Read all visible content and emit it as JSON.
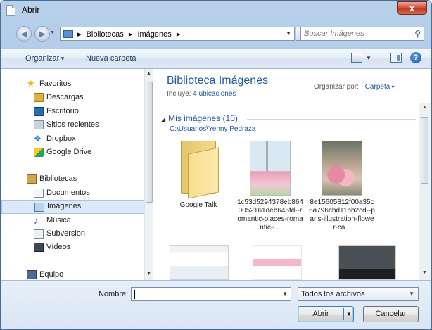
{
  "window": {
    "title": "Abrir",
    "close_glyph": "x"
  },
  "address": {
    "crumbs": [
      "Bibliotecas",
      "Imágenes"
    ],
    "search_placeholder": "Buscar Imágenes"
  },
  "toolbar": {
    "organize_label": "Organizar",
    "new_folder_label": "Nueva carpeta",
    "help_glyph": "?"
  },
  "nav": {
    "items": [
      {
        "label": "Favoritos",
        "icon": "star-icon",
        "group": true
      },
      {
        "label": "Descargas",
        "icon": "downloads-folder-icon"
      },
      {
        "label": "Escritorio",
        "icon": "desktop-icon"
      },
      {
        "label": "Sitios recientes",
        "icon": "recent-places-icon"
      },
      {
        "label": "Dropbox",
        "icon": "dropbox-icon"
      },
      {
        "label": "Google Drive",
        "icon": "google-drive-icon"
      },
      {
        "label": "Bibliotecas",
        "icon": "libraries-icon",
        "group": true
      },
      {
        "label": "Documentos",
        "icon": "documents-icon"
      },
      {
        "label": "Imágenes",
        "icon": "pictures-icon",
        "selected": true
      },
      {
        "label": "Música",
        "icon": "music-icon"
      },
      {
        "label": "Subversion",
        "icon": "subversion-icon"
      },
      {
        "label": "Vídeos",
        "icon": "videos-icon"
      },
      {
        "label": "Equipo",
        "icon": "computer-icon",
        "group": true
      }
    ]
  },
  "library": {
    "title": "Biblioteca Imágenes",
    "includes_label": "Incluye:",
    "includes_link": "4 ubicaciones",
    "arrange_label": "Organizar por:",
    "arrange_value": "Carpeta",
    "group_name": "Mis imágenes (10)",
    "group_path": "C:\\Usuarios\\Yenny Pedraza"
  },
  "files": [
    {
      "caption": "Google Talk",
      "kind": "folder"
    },
    {
      "caption": "1c53d5294378eb8640052161deb646fd--romantic-places-romantic-i...",
      "kind": "image"
    },
    {
      "caption": "8e15605812f00a35c6a796cbd11bb2cd--paris-illustration-flower-ca...",
      "kind": "image"
    }
  ],
  "bottom": {
    "filename_label": "Nombre:",
    "filename_value": "",
    "filetype_value": "Todos los archivos",
    "open_label": "Abrir",
    "cancel_label": "Cancelar"
  },
  "colors": {
    "accent_link": "#1e5aa0",
    "close_button": "#c13a21",
    "selection": "#dce9f8"
  }
}
